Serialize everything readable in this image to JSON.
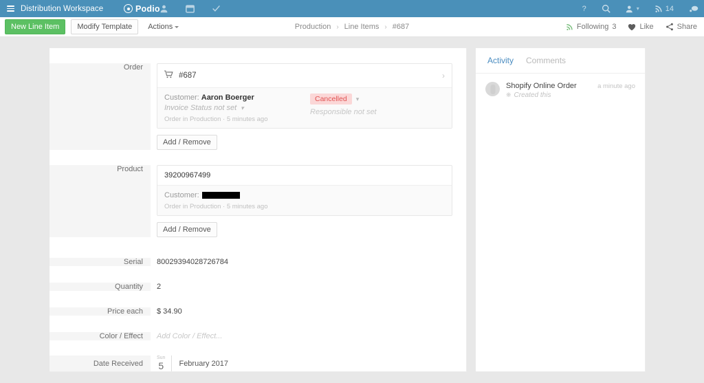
{
  "topbar": {
    "workspace": "Distribution Workspace",
    "brand": "Podio",
    "menu_icon": "hamburger-icon",
    "icons": [
      "contacts-icon",
      "apps-icon",
      "tasks-icon"
    ],
    "help_label": "?",
    "search_icon": "search-icon",
    "profile_icon": "profile-icon",
    "stream_icon": "stream-icon",
    "notification_count": "14",
    "chat_icon": "chat-icon"
  },
  "actionbar": {
    "new_item_label": "New Line Item",
    "modify_template_label": "Modify Template",
    "actions_label": "Actions",
    "breadcrumb": [
      "Production",
      "Line Items",
      "#687"
    ],
    "following_label": "Following",
    "following_count": "3",
    "like_label": "Like",
    "share_label": "Share"
  },
  "fields": {
    "order": {
      "label": "Order",
      "item_title": "#687",
      "customer_label": "Customer:",
      "customer_name": "Aaron Boerger",
      "invoice_status": "Invoice Status not set",
      "status_badge": "Cancelled",
      "responsible": "Responsible not set",
      "meta": "Order in Production · 5 minutes ago",
      "add_remove_label": "Add / Remove",
      "cart_icon": "cart-icon"
    },
    "product": {
      "label": "Product",
      "item_title": "39200967499",
      "customer_label": "Customer:",
      "customer_name_redacted": "",
      "meta": "Order in Production · 5 minutes ago",
      "add_remove_label": "Add / Remove"
    },
    "serial": {
      "label": "Serial",
      "value": "80029394028726784"
    },
    "quantity": {
      "label": "Quantity",
      "value": "2"
    },
    "price_each": {
      "label": "Price each",
      "value": "$ 34.90"
    },
    "color_effect": {
      "label": "Color / Effect",
      "placeholder": "Add Color / Effect..."
    },
    "date_received": {
      "label": "Date Received",
      "day_of_week": "Sun",
      "day": "5",
      "month_year": "February 2017"
    }
  },
  "activity": {
    "tabs": [
      {
        "label": "Activity",
        "active": true
      },
      {
        "label": "Comments",
        "active": false
      }
    ],
    "items": [
      {
        "author": "Shopify Online Order",
        "action": "Created this",
        "time": "a minute ago",
        "avatar_icon": "avatar-icon",
        "action_icon": "sparkle-icon"
      }
    ]
  },
  "colors": {
    "topbar": "#4a90b9",
    "accent_green": "#5cc063",
    "link_blue": "#4a8cc0",
    "badge_bg": "#fbd7d7",
    "badge_text": "#e05252",
    "page_bg": "#e8e8e8"
  }
}
